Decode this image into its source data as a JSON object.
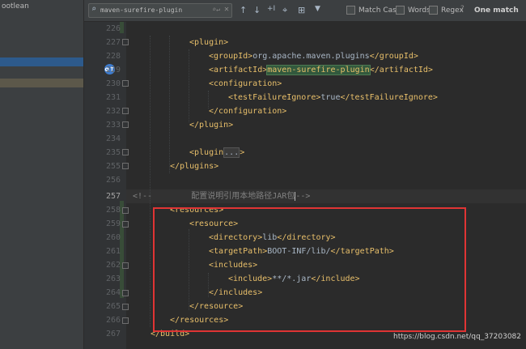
{
  "sidebar": {
    "title": "ootlean"
  },
  "find": {
    "query": "maven-surefire-plugin",
    "search_options": "⌕↵",
    "clear": "✕",
    "prev_label": "↑",
    "next_label": "↓",
    "add_cursor_label": "+I",
    "select_all_label": "⌖",
    "select_all_occ_label": "⊞",
    "filter_label": "▼",
    "match_case": "Match Case",
    "words": "Words",
    "regex": "Regex",
    "help": "?",
    "match_info": "One match"
  },
  "lines": [
    {
      "n": "226",
      "parts": []
    },
    {
      "n": "227",
      "parts": [
        {
          "c": "t",
          "v": "<plugin>"
        }
      ]
    },
    {
      "n": "228",
      "parts": [
        {
          "c": "t",
          "v": "<groupId>"
        },
        {
          "c": "p",
          "v": "org.apache.maven.plugins"
        },
        {
          "c": "t",
          "v": "</groupId>"
        }
      ]
    },
    {
      "n": "229",
      "parts": [
        {
          "c": "t",
          "v": "<artifactId>"
        },
        {
          "c": "m",
          "v": "maven-surefire-plugin"
        },
        {
          "c": "t",
          "v": "</artifactId>"
        }
      ]
    },
    {
      "n": "230",
      "parts": [
        {
          "c": "t",
          "v": "<configuration>"
        }
      ]
    },
    {
      "n": "231",
      "parts": [
        {
          "c": "t",
          "v": "<testFailureIgnore>"
        },
        {
          "c": "p",
          "v": "true"
        },
        {
          "c": "t",
          "v": "</testFailureIgnore>"
        }
      ]
    },
    {
      "n": "232",
      "parts": [
        {
          "c": "t",
          "v": "</configuration>"
        }
      ]
    },
    {
      "n": "233",
      "parts": [
        {
          "c": "t",
          "v": "</plugin>"
        }
      ]
    },
    {
      "n": "234",
      "parts": []
    },
    {
      "n": "235",
      "parts": [
        {
          "c": "t",
          "v": "<plugin"
        },
        {
          "c": "f",
          "v": "..."
        },
        {
          "c": "t",
          "v": ">"
        }
      ]
    },
    {
      "n": "255",
      "parts": [
        {
          "c": "t",
          "v": "</plugins>"
        }
      ]
    },
    {
      "n": "256",
      "parts": []
    },
    {
      "n": "257",
      "parts": [
        {
          "c": "c",
          "v": "<!--        配置说明引用本地路径JAR包"
        },
        {
          "c": "caret",
          "v": ""
        },
        {
          "c": "c",
          "v": "-->"
        }
      ]
    },
    {
      "n": "258",
      "parts": [
        {
          "c": "t",
          "v": "<resources>"
        }
      ]
    },
    {
      "n": "259",
      "parts": [
        {
          "c": "t",
          "v": "<resource>"
        }
      ]
    },
    {
      "n": "260",
      "parts": [
        {
          "c": "t",
          "v": "<directory>"
        },
        {
          "c": "p",
          "v": "lib"
        },
        {
          "c": "t",
          "v": "</directory>"
        }
      ]
    },
    {
      "n": "261",
      "parts": [
        {
          "c": "t",
          "v": "<targetPath>"
        },
        {
          "c": "p",
          "v": "BOOT-INF/lib/"
        },
        {
          "c": "t",
          "v": "</targetPath>"
        }
      ]
    },
    {
      "n": "262",
      "parts": [
        {
          "c": "t",
          "v": "<includes>"
        }
      ]
    },
    {
      "n": "263",
      "parts": [
        {
          "c": "t",
          "v": "<include>"
        },
        {
          "c": "p",
          "v": "**/*.jar"
        },
        {
          "c": "t",
          "v": "</include>"
        }
      ]
    },
    {
      "n": "264",
      "parts": [
        {
          "c": "t",
          "v": "</includes>"
        }
      ]
    },
    {
      "n": "265",
      "parts": [
        {
          "c": "t",
          "v": "</resource>"
        }
      ]
    },
    {
      "n": "266",
      "parts": [
        {
          "c": "t",
          "v": "</resources>"
        }
      ]
    },
    {
      "n": "267",
      "parts": [
        {
          "c": "t",
          "v": "</build>"
        }
      ]
    }
  ],
  "watermark": "https://blog.csdn.net/qq_37203082"
}
